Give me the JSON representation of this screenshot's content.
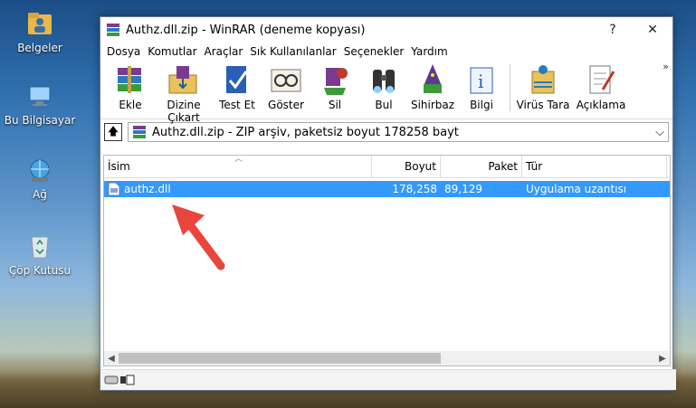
{
  "desktop": {
    "icons": [
      {
        "label": "Belgeler",
        "icon": "folder-user-icon"
      },
      {
        "label": "Bu Bilgisayar",
        "icon": "computer-icon"
      },
      {
        "label": "Ağ",
        "icon": "network-globe-icon"
      },
      {
        "label": "Çöp Kutusu",
        "icon": "recycle-bin-icon"
      }
    ]
  },
  "window": {
    "title": "Authz.dll.zip - WinRAR (deneme kopyası)",
    "help_label": "?",
    "close_label": "✕"
  },
  "menu": [
    "Dosya",
    "Komutlar",
    "Araçlar",
    "Sık Kullanılanlar",
    "Seçenekler",
    "Yardım"
  ],
  "toolbar": {
    "buttons": [
      {
        "label": "Ekle",
        "icon": "add-archive-icon"
      },
      {
        "label": "Dizine Çıkart",
        "icon": "extract-to-icon"
      },
      {
        "label": "Test Et",
        "icon": "test-icon"
      },
      {
        "label": "Göster",
        "icon": "view-icon"
      },
      {
        "label": "Sil",
        "icon": "delete-icon"
      },
      {
        "label": "Bul",
        "icon": "find-icon"
      },
      {
        "label": "Sihirbaz",
        "icon": "wizard-icon"
      },
      {
        "label": "Bilgi",
        "icon": "info-icon"
      },
      {
        "label": "Virüs Tara",
        "icon": "virus-scan-icon"
      },
      {
        "label": "Açıklama",
        "icon": "comment-icon"
      }
    ],
    "more": "»"
  },
  "address": {
    "path": "Authz.dll.zip - ZIP arşiv, paketsiz boyut 178258 bayt",
    "dropdown": "⌵"
  },
  "columns": [
    "İsim",
    "Boyut",
    "Paket",
    "Tür"
  ],
  "files": [
    {
      "name": "authz.dll",
      "size": "178,258",
      "packed": "89,129",
      "type": "Uygulama uzantısı",
      "selected": true
    }
  ],
  "colors": {
    "selection": "#3399ff",
    "annotation_arrow": "#e8463c"
  }
}
